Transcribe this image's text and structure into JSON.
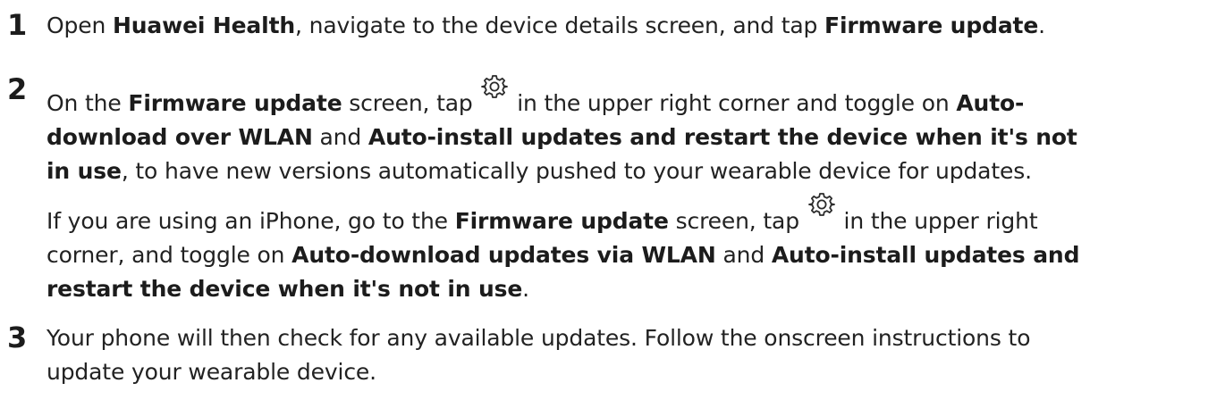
{
  "steps": [
    {
      "number": "1",
      "p1": {
        "t1": "Open ",
        "b1": "Huawei Health",
        "t2": ", navigate to the device details screen, and tap ",
        "b2": "Firmware update",
        "t3": "."
      }
    },
    {
      "number": "2",
      "p1": {
        "t1": "On the ",
        "b1": "Firmware update",
        "t2": " screen, tap ",
        "t3": " in the upper right corner and toggle on ",
        "b2": "Auto-",
        "b3": "download over WLAN",
        "t4": " and ",
        "b4": "Auto-install updates and restart the device when it's not",
        "b5": "in use",
        "t5": ", to have new versions automatically pushed to your wearable device for updates."
      },
      "p2": {
        "t1": "If you are using an iPhone, go to the ",
        "b1": "Firmware update",
        "t2": " screen, tap ",
        "t3": " in the upper right",
        "t4": "corner, and toggle on ",
        "b2": "Auto-download updates via WLAN",
        "t5": " and ",
        "b3": "Auto-install updates and",
        "b4": "restart the device when it's not in use",
        "t6": "."
      }
    },
    {
      "number": "3",
      "p1": {
        "t1": "Your phone will then check for any available updates. Follow the onscreen instructions to",
        "t2": "update your wearable device."
      }
    }
  ],
  "icons": {
    "settings": "gear-icon"
  }
}
